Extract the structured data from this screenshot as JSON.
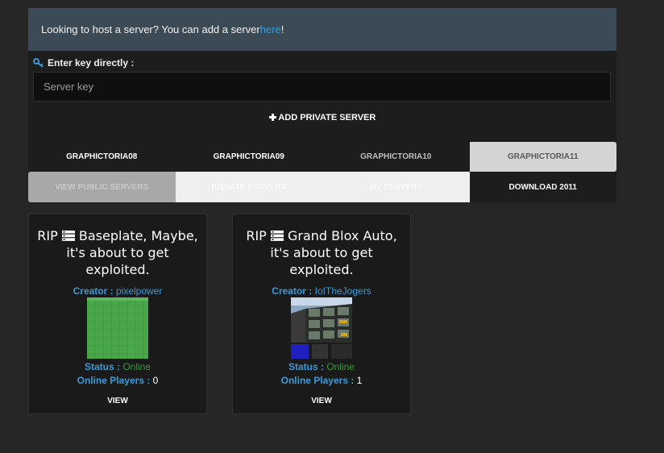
{
  "notice": {
    "text": "Looking to host a server? You can add a server ",
    "link": "here",
    "suffix": "!"
  },
  "key": {
    "label": "Enter key directly :",
    "placeholder": "Server key",
    "value": ""
  },
  "add_private_label": "ADD PRIVATE SERVER",
  "version_tabs": [
    {
      "label": "GRAPHICTORIA08"
    },
    {
      "label": "GRAPHICTORIA09"
    },
    {
      "label": "GRAPHICTORIA10"
    },
    {
      "label": "GRAPHICTORIA11"
    }
  ],
  "server_tabs": [
    {
      "label": "VIEW PUBLIC SERVERS"
    },
    {
      "label": "PRIVATE SERVERS"
    },
    {
      "label": "MY SERVERS"
    },
    {
      "label": "DOWNLOAD 2011"
    }
  ],
  "servers": [
    {
      "title_prefix": "RIP",
      "title": "Baseplate, Maybe, it's about to get exploited.",
      "creator_label": "Creator :",
      "creator": "pixelpower",
      "status_label": "Status :",
      "status": "Online",
      "players_label": "Online Players :",
      "players": "0",
      "view_label": "VIEW"
    },
    {
      "title_prefix": "RIP",
      "title": "Grand Blox Auto, it's about to get exploited.",
      "creator_label": "Creator :",
      "creator": "IoITheJogers",
      "status_label": "Status :",
      "status": "Online",
      "players_label": "Online Players :",
      "players": "1",
      "view_label": "VIEW"
    }
  ],
  "colors": {
    "accent": "#3a9ad9",
    "online": "#2f9a3a",
    "background": "#262626"
  }
}
